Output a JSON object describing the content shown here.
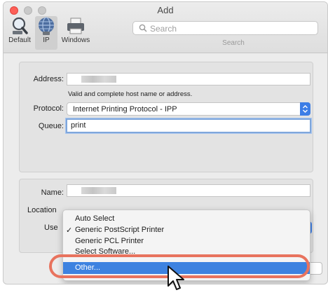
{
  "window": {
    "title": "Add"
  },
  "toolbar": {
    "default_label": "Default",
    "ip_label": "IP",
    "windows_label": "Windows",
    "search_placeholder": "Search",
    "search_label": "Search"
  },
  "form": {
    "address_label": "Address:",
    "address_hint": "Valid and complete host name or address.",
    "protocol_label": "Protocol:",
    "protocol_value": "Internet Printing Protocol - IPP",
    "queue_label": "Queue:",
    "queue_value": "print",
    "name_label": "Name:",
    "location_label": "Location",
    "use_label": "Use"
  },
  "use_menu": {
    "items": [
      {
        "label": "Auto Select",
        "checked": false,
        "highlighted": false
      },
      {
        "label": "Generic PostScript Printer",
        "checked": true,
        "highlighted": false
      },
      {
        "label": "Generic PCL Printer",
        "checked": false,
        "highlighted": false
      },
      {
        "label": "Select Software...",
        "checked": false,
        "highlighted": false
      },
      {
        "label": "Other...",
        "checked": false,
        "highlighted": true
      }
    ],
    "check_glyph": "✓"
  },
  "colors": {
    "accent": "#3d7ee6",
    "highlight": "#3d82e0",
    "callout_ring": "#e8735e",
    "close_button": "#fd5f57"
  }
}
